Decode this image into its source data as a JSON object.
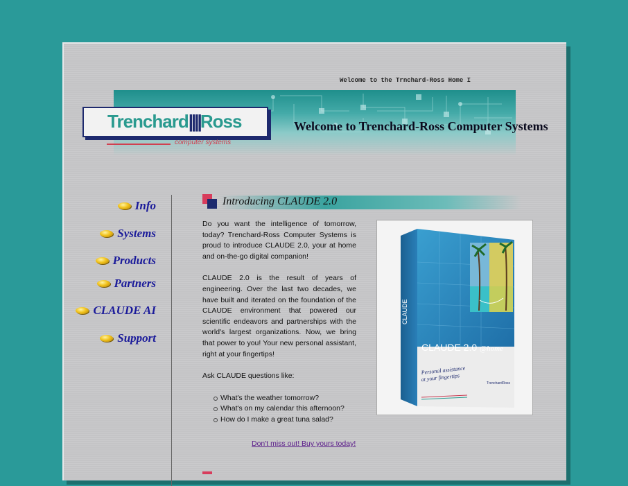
{
  "marquee": "Welcome to the Trnchard-Ross Home I",
  "logo": {
    "name_part1": "Trenchard",
    "name_part2": "Ross",
    "tagline": "computer systems"
  },
  "welcome_heading": "Welcome to Trenchard-Ross Computer Systems",
  "nav": {
    "items": [
      {
        "label": "Info"
      },
      {
        "label": "Systems"
      },
      {
        "label": "Products"
      },
      {
        "label": "Partners"
      },
      {
        "label": "CLAUDE AI"
      },
      {
        "label": "Support"
      }
    ]
  },
  "section": {
    "heading": "Introducing CLAUDE 2.0",
    "paragraphs": [
      "Do you want the intelligence of tomorrow, today? Trenchard-Ross Computer Systems is proud to introduce CLAUDE 2.0, your at home and on-the-go digital companion!",
      "CLAUDE 2.0 is the result of years of engineering. Over the last two decades, we have built and iterated on the foundation of the CLAUDE environment that powered our scientific endeavors and partnerships with the world's largest organizations. Now, we bring that power to you! Your new personal assistant, right at your fingertips!",
      "Ask CLAUDE questions like:"
    ],
    "questions": [
      "What's the weather tomorrow?",
      "What's on my calendar this afternoon?",
      "How do I make a great tuna salad?"
    ],
    "cta_link": "Don't miss out! Buy yours today!"
  },
  "product_box": {
    "title": "CLAUDE 2.0",
    "title_suffix": "@home",
    "subtitle_line1": "Personal assistance",
    "subtitle_line2": "at your fingertips",
    "brand": "TrenchardRoss",
    "spine": "CLAUDE"
  },
  "colors": {
    "background": "#2a9a99",
    "page": "#c4c4c6",
    "nav_text": "#1a1a9a",
    "accent_pink": "#d83c5c",
    "navy": "#1e2a6e",
    "link_visited": "#5a1a8a"
  }
}
